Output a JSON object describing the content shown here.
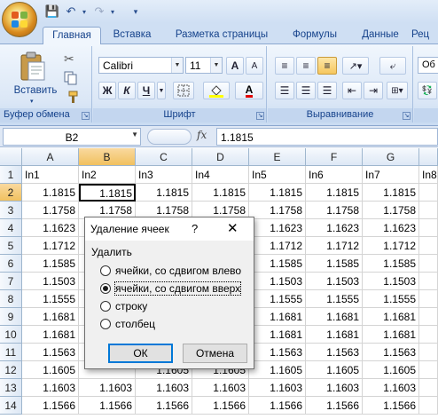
{
  "quick_access": {
    "save": "💾",
    "undo": "↶",
    "redo": "↷",
    "customize": "▾"
  },
  "tabs": [
    "Главная",
    "Вставка",
    "Разметка страницы",
    "Формулы",
    "Данные",
    "Рец"
  ],
  "active_tab": "Главная",
  "ribbon": {
    "clipboard": {
      "paste_label": "Вставить",
      "group_label": "Буфер обмена"
    },
    "font": {
      "font_name": "Calibri",
      "font_size": "11",
      "group_label": "Шрифт",
      "bold": "Ж",
      "italic": "К",
      "underline": "Ч",
      "grow": "A",
      "shrink": "A",
      "font_color": "A"
    },
    "alignment": {
      "group_label": "Выравнивание"
    },
    "number": {
      "partial": "Об"
    }
  },
  "formula_bar": {
    "name_box": "B2",
    "fx": "fx",
    "value": "1.1815"
  },
  "columns": [
    "A",
    "B",
    "C",
    "D",
    "E",
    "F",
    "G"
  ],
  "selected_column": "B",
  "rows": [
    [
      "In1",
      "In2",
      "In3",
      "In4",
      "In5",
      "In6",
      "In7",
      "In8"
    ],
    [
      "1.1815",
      "1.1815",
      "1.1815",
      "1.1815",
      "1.1815",
      "1.1815",
      "1.1815"
    ],
    [
      "1.1758",
      "1.1758",
      "1.1758",
      "1.1758",
      "1.1758",
      "1.1758",
      "1.1758"
    ],
    [
      "1.1623",
      "",
      "",
      "",
      "1.1623",
      "1.1623",
      "1.1623"
    ],
    [
      "1.1712",
      "",
      "",
      "",
      "1.1712",
      "1.1712",
      "1.1712"
    ],
    [
      "1.1585",
      "",
      "",
      "",
      "1.1585",
      "1.1585",
      "1.1585"
    ],
    [
      "1.1503",
      "",
      "",
      "",
      "1.1503",
      "1.1503",
      "1.1503"
    ],
    [
      "1.1555",
      "",
      "",
      "",
      "1.1555",
      "1.1555",
      "1.1555"
    ],
    [
      "1.1681",
      "",
      "",
      "",
      "1.1681",
      "1.1681",
      "1.1681"
    ],
    [
      "1.1681",
      "",
      "",
      "",
      "1.1681",
      "1.1681",
      "1.1681"
    ],
    [
      "1.1563",
      "",
      "",
      "",
      "1.1563",
      "1.1563",
      "1.1563"
    ],
    [
      "1.1605",
      "",
      "1.1605",
      "1.1605",
      "1.1605",
      "1.1605",
      "1.1605"
    ],
    [
      "1.1603",
      "1.1603",
      "1.1603",
      "1.1603",
      "1.1603",
      "1.1603",
      "1.1603"
    ],
    [
      "1.1566",
      "1.1566",
      "1.1566",
      "1.1566",
      "1.1566",
      "1.1566",
      "1.1566"
    ]
  ],
  "row_numbers": [
    "1",
    "2",
    "3",
    "4",
    "5",
    "6",
    "7",
    "8",
    "9",
    "10",
    "11",
    "12",
    "13",
    "14"
  ],
  "active_cell": "B2",
  "dialog": {
    "title": "Удаление ячеек",
    "help": "?",
    "close": "✕",
    "group_label": "Удалить",
    "options": [
      {
        "label": "ячейки, со сдвигом влево",
        "checked": false
      },
      {
        "label": "ячейки, со сдвигом вверх",
        "checked": true
      },
      {
        "label": "строку",
        "checked": false
      },
      {
        "label": "столбец",
        "checked": false
      }
    ],
    "ok": "ОК",
    "cancel": "Отмена"
  }
}
